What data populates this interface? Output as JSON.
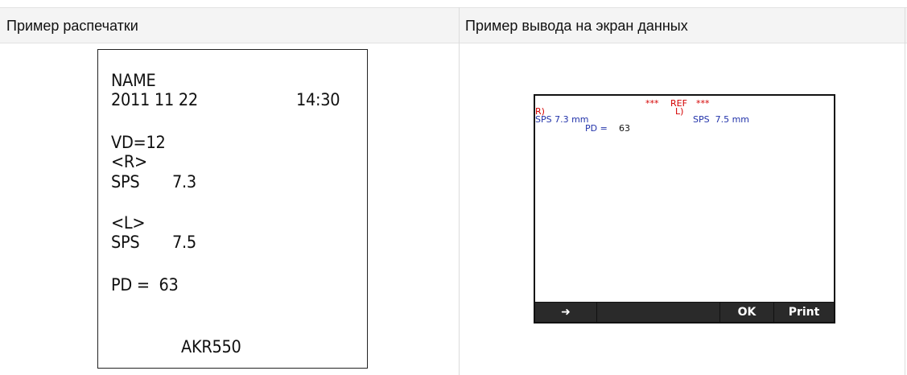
{
  "table": {
    "header_left": "Пример распечатки",
    "header_right": "Пример вывода на экран данных"
  },
  "printout": {
    "name": "NAME",
    "date": "2011 11 22",
    "time": "14:30",
    "vd": "VD=12",
    "right_marker": "<R>",
    "sps_r_label": "SPS",
    "sps_r_value": "7.3",
    "left_marker": "<L>",
    "sps_l_label": "SPS",
    "sps_l_value": "7.5",
    "pd": "PD =  63",
    "model": "AKR550"
  },
  "screen": {
    "stars_left": "***",
    "mode": "REF",
    "stars_right": "***",
    "r_label": "R)",
    "l_label": "L)",
    "sps_r": "SPS 7.3 mm",
    "sps_l": "SPS  7.5 mm",
    "pd_label": "PD =",
    "pd_value": "63",
    "buttons": {
      "arrow": "➜",
      "empty": "",
      "ok": "OK",
      "print": "Print"
    }
  }
}
